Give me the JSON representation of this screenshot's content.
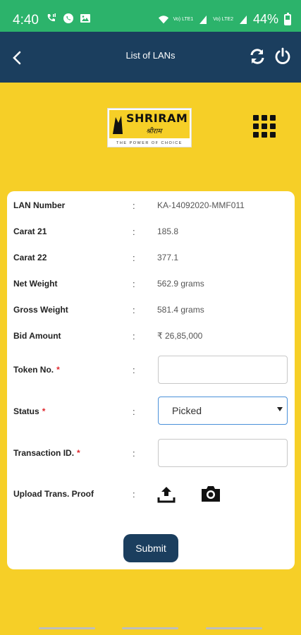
{
  "status_bar": {
    "time": "4:40",
    "battery": "44%",
    "battery_level": 0.44,
    "network_1": "Vo) LTE1",
    "network_2": "Vo) LTE2",
    "icons": [
      "wifi-calling-icon",
      "whatsapp-icon",
      "gallery-icon",
      "wifi-icon",
      "signal-icon",
      "battery-icon"
    ]
  },
  "app_bar": {
    "title": "List of LANs",
    "icons": [
      "back-arrow-icon",
      "refresh-icon",
      "power-icon"
    ]
  },
  "logo": {
    "name": "SHRIRAM",
    "script": "श्रीराम",
    "tagline": "THE POWER OF CHOICE"
  },
  "details": [
    {
      "label": "LAN Number",
      "value": "KA-14092020-MMF011"
    },
    {
      "label": "Carat 21",
      "value": "185.8"
    },
    {
      "label": "Carat 22",
      "value": "377.1"
    },
    {
      "label": "Net Weight",
      "value": "562.9 grams"
    },
    {
      "label": "Gross Weight",
      "value": "581.4 grams"
    },
    {
      "label": "Bid Amount",
      "value": "₹ 26,85,000"
    }
  ],
  "form": {
    "separator": ":",
    "required_mark": "*",
    "token": {
      "label": "Token No.",
      "value": ""
    },
    "status": {
      "label": "Status",
      "selected": "Picked"
    },
    "transaction": {
      "label": "Transaction ID.",
      "value": ""
    },
    "upload": {
      "label": "Upload Trans. Proof"
    },
    "submit_label": "Submit"
  },
  "colors": {
    "status_bar": "#2cb36b",
    "app_bar": "#1b3e5e",
    "background": "#f6cf27",
    "required": "#e0282e"
  }
}
